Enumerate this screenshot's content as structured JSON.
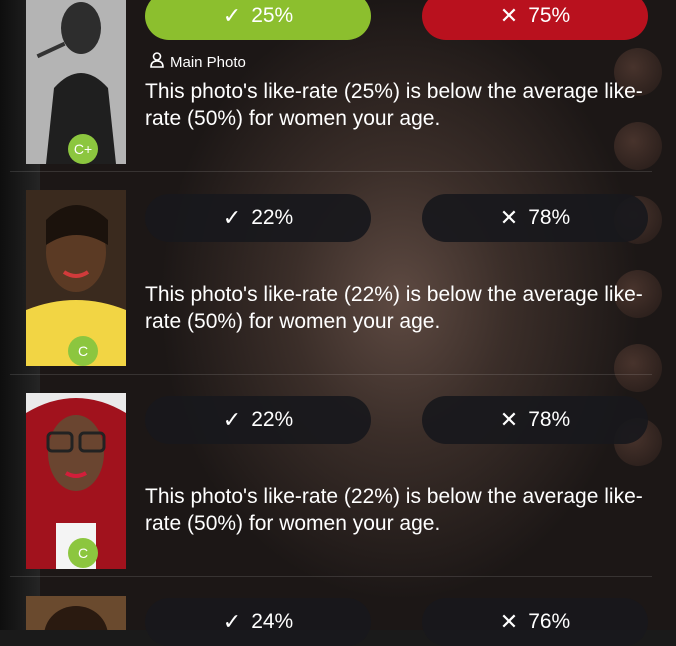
{
  "rows": [
    {
      "grade": "C+",
      "like_pct": "25%",
      "dislike_pct": "75%",
      "like_active": true,
      "dislike_active": true,
      "main_photo_label": "Main Photo",
      "description": "This photo's like-rate (25%) is below the average like-rate (50%) for women your age."
    },
    {
      "grade": "C",
      "like_pct": "22%",
      "dislike_pct": "78%",
      "description": "This photo's like-rate (22%) is below the average like-rate (50%) for women your age."
    },
    {
      "grade": "C",
      "like_pct": "22%",
      "dislike_pct": "78%",
      "description": "This photo's like-rate (22%) is below the average like-rate (50%) for women your age."
    },
    {
      "like_pct": "24%",
      "dislike_pct": "76%"
    }
  ],
  "icons": {
    "like": "✓",
    "dislike": "✕",
    "person": "person-icon"
  },
  "colors": {
    "like_active": "#8cbf2e",
    "dislike_active": "#b9111e",
    "grade_badge": "#8cc63f",
    "pill_inactive": "#18181c"
  }
}
